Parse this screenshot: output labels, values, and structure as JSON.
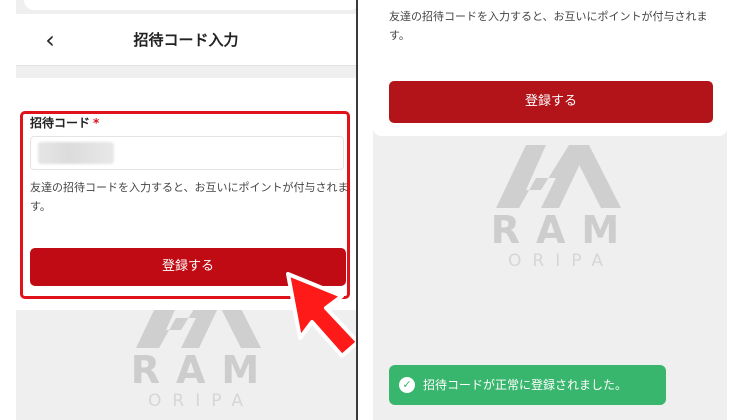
{
  "left": {
    "header": {
      "back_icon": "chevron-left-icon",
      "back_glyph": "‹",
      "title": "招待コード入力"
    },
    "form": {
      "label": "招待コード",
      "required_mark": "*",
      "input_value": "",
      "helper": "友達の招待コードを入力すると、お互いにポイントが付与されます。",
      "submit_label": "登録する"
    }
  },
  "right": {
    "helper": "友達の招待コードを入力すると、お互いにポイントが付与されます。",
    "submit_label": "登録する",
    "toast": {
      "icon": "check-circle-icon",
      "icon_glyph": "✓",
      "message": "招待コードが正常に登録されました。"
    }
  },
  "watermark": {
    "brand": "RAM",
    "sub": "ORIPA"
  },
  "colors": {
    "accent_red": "#c10b14",
    "highlight_red": "#e0121a",
    "success_green": "#39b66e",
    "background": "#efefef"
  }
}
